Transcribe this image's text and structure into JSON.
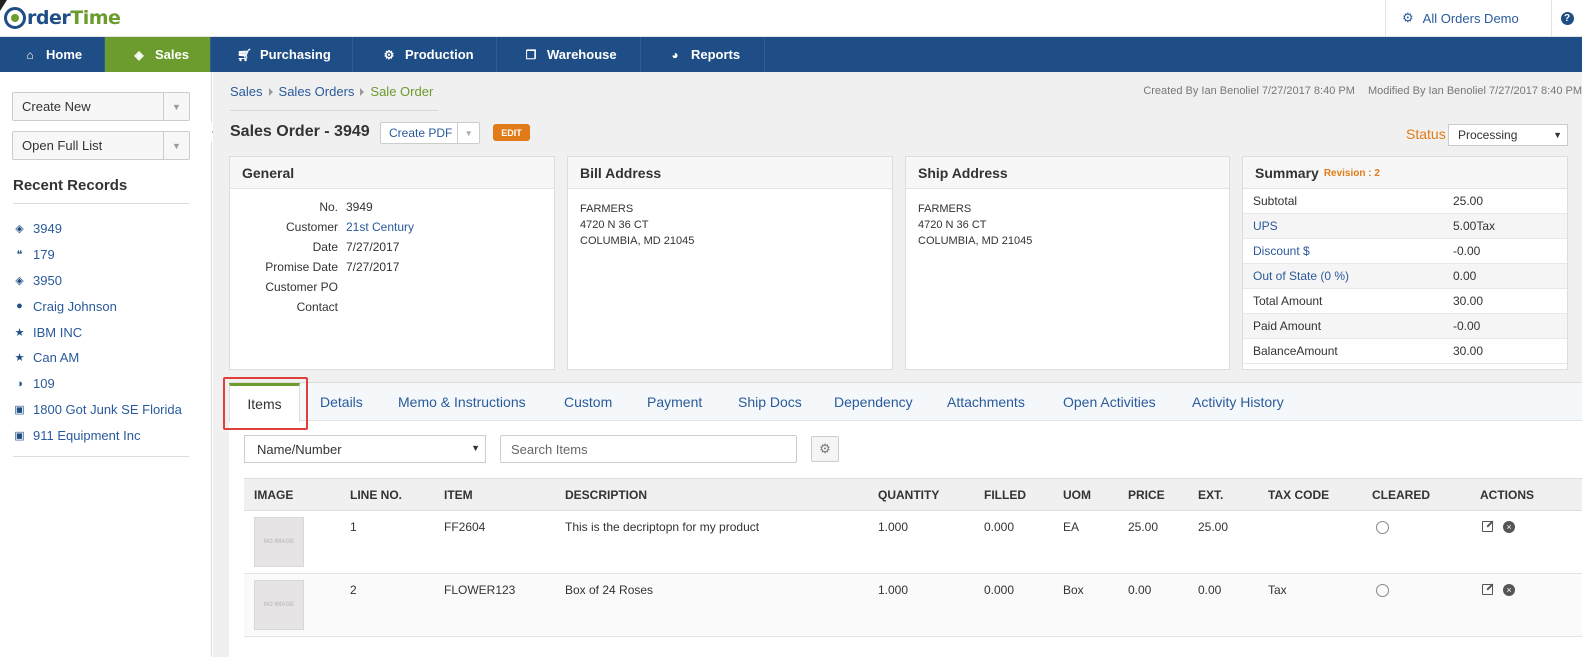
{
  "app": {
    "logo_prefix": "rder",
    "logo_suffix": "Time"
  },
  "account": {
    "name": "All Orders Demo",
    "help": "?"
  },
  "nav": [
    {
      "label": "Home",
      "icon": "home-icon"
    },
    {
      "label": "Sales",
      "icon": "tag-icon",
      "active": true
    },
    {
      "label": "Purchasing",
      "icon": "cart-icon"
    },
    {
      "label": "Production",
      "icon": "cogs-icon"
    },
    {
      "label": "Warehouse",
      "icon": "cube-icon"
    },
    {
      "label": "Reports",
      "icon": "pie-chart-icon"
    }
  ],
  "sidebar": {
    "create_new": "Create New",
    "open_full_list": "Open Full List",
    "recent_title": "Recent Records",
    "recent": [
      {
        "label": "3949",
        "icon": "tag-icon"
      },
      {
        "label": "179",
        "icon": "quote-icon"
      },
      {
        "label": "3950",
        "icon": "tag-icon"
      },
      {
        "label": "Craig Johnson",
        "icon": "user-icon"
      },
      {
        "label": "IBM INC",
        "icon": "star-icon"
      },
      {
        "label": "Can AM",
        "icon": "star-icon"
      },
      {
        "label": "109",
        "icon": "half-circle-icon"
      },
      {
        "label": "1800 Got Junk SE Florida",
        "icon": "archive-icon"
      },
      {
        "label": "911 Equipment Inc",
        "icon": "archive-icon"
      }
    ]
  },
  "breadcrumb": [
    "Sales",
    "Sales Orders",
    "Sale Order"
  ],
  "meta": {
    "created": "Created By Ian Benoliel 7/27/2017 8:40 PM",
    "modified": "Modified By Ian Benoliel 7/27/2017 8:40 PM"
  },
  "header": {
    "title": "Sales Order - 3949",
    "create_pdf": "Create PDF",
    "edit": "EDIT",
    "status_label": "Status",
    "status_value": "Processing"
  },
  "general": {
    "title": "General",
    "rows": [
      {
        "k": "No.",
        "v": "3949"
      },
      {
        "k": "Customer",
        "v": "21st Century",
        "link": true
      },
      {
        "k": "Date",
        "v": "7/27/2017"
      },
      {
        "k": "Promise Date",
        "v": "7/27/2017"
      },
      {
        "k": "Customer PO",
        "v": ""
      },
      {
        "k": "Contact",
        "v": ""
      }
    ]
  },
  "bill": {
    "title": "Bill Address",
    "lines": [
      "FARMERS",
      "4720 N 36 CT",
      "COLUMBIA, MD 21045"
    ]
  },
  "ship": {
    "title": "Ship Address",
    "lines": [
      "FARMERS",
      "4720 N 36 CT",
      "COLUMBIA, MD 21045"
    ]
  },
  "summary": {
    "title": "Summary",
    "revision": "Revision : 2",
    "rows": [
      {
        "k": "Subtotal",
        "v": "25.00"
      },
      {
        "k": "UPS",
        "v": "5.00Tax",
        "link": true
      },
      {
        "k": "Discount $",
        "v": "-0.00",
        "link": true
      },
      {
        "k": "Out of State (0 %)",
        "v": "0.00",
        "link": true
      },
      {
        "k": "Total Amount",
        "v": "30.00"
      },
      {
        "k": "Paid Amount",
        "v": "-0.00"
      },
      {
        "k": "BalanceAmount",
        "v": "30.00"
      }
    ]
  },
  "tabs": [
    "Items",
    "Details",
    "Memo & Instructions",
    "Custom",
    "Payment",
    "Ship Docs",
    "Dependency",
    "Attachments",
    "Open Activities",
    "Activity History"
  ],
  "items": {
    "filter": "Name/Number",
    "search_placeholder": "Search Items",
    "columns": [
      "IMAGE",
      "LINE NO.",
      "ITEM",
      "DESCRIPTION",
      "QUANTITY",
      "FILLED",
      "UOM",
      "PRICE",
      "EXT.",
      "TAX CODE",
      "CLEARED",
      "ACTIONS"
    ],
    "no_image": "NO IMAGE",
    "rows": [
      {
        "line": "1",
        "item": "FF2604",
        "description": "This is the decriptopn for my product",
        "quantity": "1.000",
        "filled": "0.000",
        "uom": "EA",
        "price": "25.00",
        "ext": "25.00",
        "tax": ""
      },
      {
        "line": "2",
        "item": "FLOWER123",
        "description": "Box of 24 Roses",
        "quantity": "1.000",
        "filled": "0.000",
        "uom": "Box",
        "price": "0.00",
        "ext": "0.00",
        "tax": "Tax"
      }
    ]
  }
}
